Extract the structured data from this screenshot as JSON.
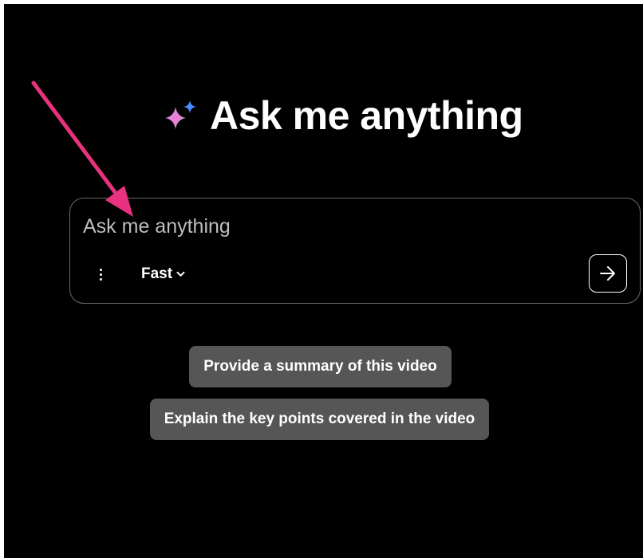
{
  "hero": {
    "title": "Ask me anything",
    "icon": "sparkle-icon"
  },
  "prompt": {
    "placeholder": "Ask me anything",
    "value": "",
    "more_icon": "more-vertical-icon",
    "mode": {
      "selected": "Fast",
      "icon": "chevron-down-icon"
    },
    "send_icon": "arrow-right-icon"
  },
  "suggestions": [
    {
      "label": "Provide a summary of this video"
    },
    {
      "label": "Explain the key points covered in the video"
    }
  ],
  "annotation": {
    "type": "arrow",
    "color": "#e8317f"
  },
  "colors": {
    "background": "#000000",
    "chip_background": "#565656",
    "border": "#6a6a6a",
    "sparkle_blue": "#4a8cff",
    "sparkle_pink": "#f07ad6"
  }
}
